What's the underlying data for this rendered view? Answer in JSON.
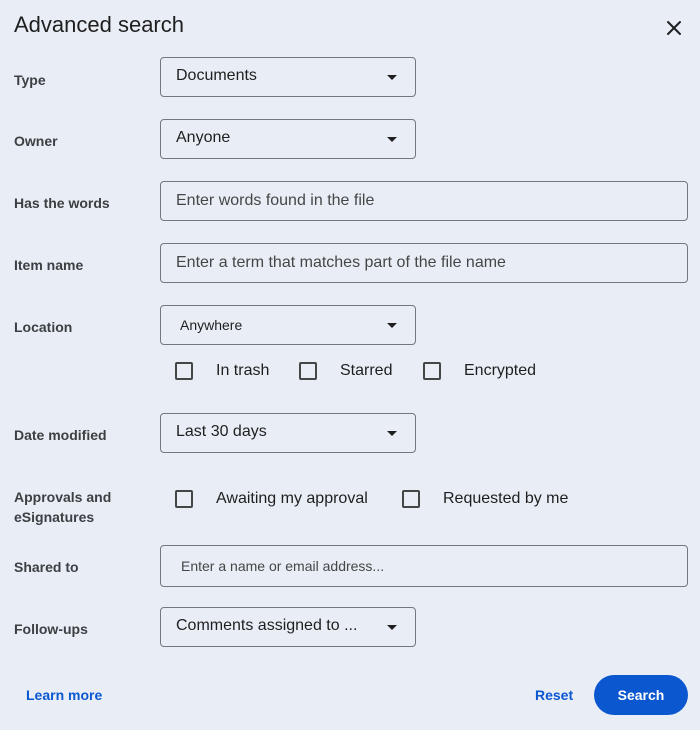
{
  "dialog": {
    "title": "Advanced search",
    "close_icon": "close-icon"
  },
  "fields": {
    "type": {
      "label": "Type",
      "value": "Documents"
    },
    "owner": {
      "label": "Owner",
      "value": "Anyone"
    },
    "has_words": {
      "label": "Has the words",
      "placeholder": "Enter words found in the file"
    },
    "item_name": {
      "label": "Item name",
      "placeholder": "Enter a term that matches part of the file name"
    },
    "location": {
      "label": "Location",
      "value": "Anywhere",
      "checkboxes": [
        {
          "label": "In trash",
          "checked": false
        },
        {
          "label": "Starred",
          "checked": false
        },
        {
          "label": "Encrypted",
          "checked": false
        }
      ]
    },
    "date_modified": {
      "label": "Date modified",
      "value": "Last 30 days"
    },
    "approvals": {
      "label_line1": "Approvals and",
      "label_line2": "eSignatures",
      "checkboxes": [
        {
          "label": "Awaiting my approval",
          "checked": false
        },
        {
          "label": "Requested by me",
          "checked": false
        }
      ]
    },
    "shared_to": {
      "label": "Shared to",
      "placeholder": "Enter a name or email address..."
    },
    "follow_ups": {
      "label": "Follow-ups",
      "value": "Comments assigned to ..."
    }
  },
  "footer": {
    "learn_more": "Learn more",
    "reset": "Reset",
    "search": "Search"
  },
  "colors": {
    "background": "#e9eef6",
    "accent": "#0b57d0",
    "border": "#74777f"
  }
}
